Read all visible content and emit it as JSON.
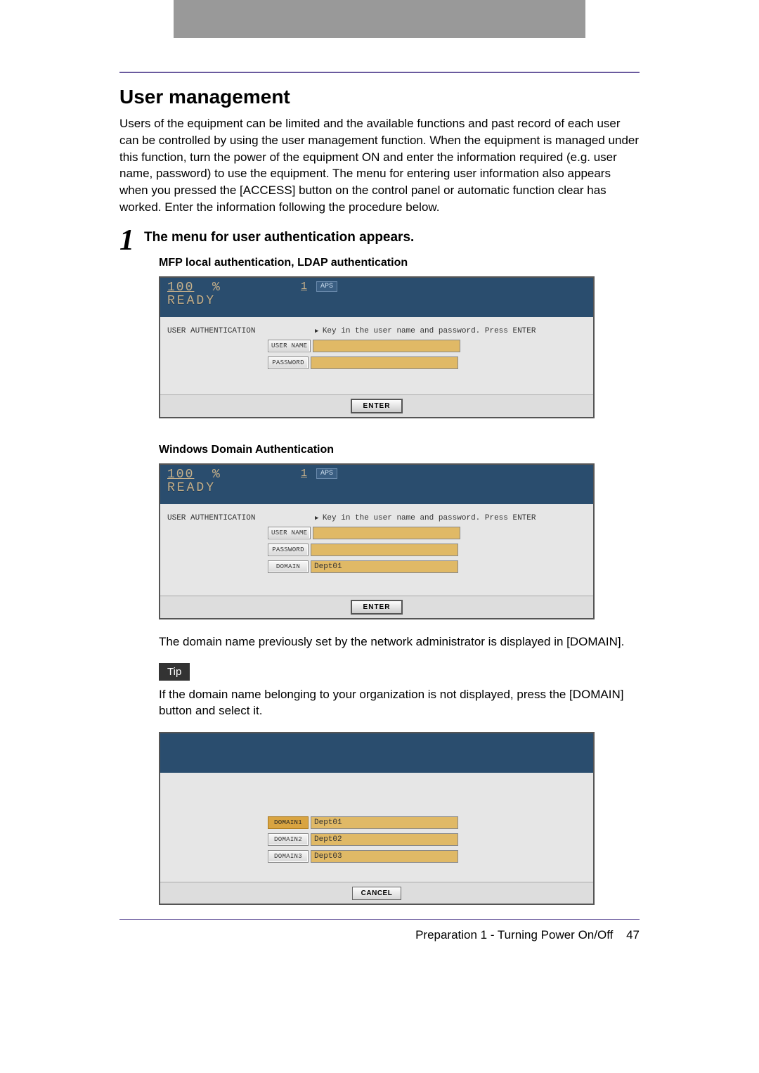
{
  "heading": "User management",
  "intro": "Users of the equipment can be limited and the available functions and past record of each user can be controlled by using the user management function. When the equipment is managed under this function, turn the power of the equipment ON and enter the information required (e.g. user name, password) to use the equipment. The menu for entering user information also appears when you pressed the [ACCESS] button on the control panel or automatic function clear has worked. Enter the information following the procedure below.",
  "step": {
    "num": "1",
    "title": "The menu for user authentication appears.",
    "sub1": "MFP local authentication, LDAP authentication",
    "sub2": "Windows Domain Authentication"
  },
  "panel": {
    "percent": "100",
    "pct_sym": "%",
    "ready": "READY",
    "one": "1",
    "aps": "APS",
    "ua": "USER AUTHENTICATION",
    "instr": "Key in the user name and password. Press ENTER",
    "username_label": "USER NAME",
    "password_label": "PASSWORD",
    "domain_label": "DOMAIN",
    "domain_value": "Dept01",
    "enter": "ENTER",
    "cancel": "CANCEL"
  },
  "after_panel2": "The domain name previously set by the network administrator is displayed in [DOMAIN].",
  "tip_label": "Tip",
  "tip_text": "If the domain name belonging to your organization is not displayed, press the [DOMAIN] button and select it.",
  "domains": {
    "d1_label": "DOMAIN1",
    "d1_val": "Dept01",
    "d2_label": "DOMAIN2",
    "d2_val": "Dept02",
    "d3_label": "DOMAIN3",
    "d3_val": "Dept03"
  },
  "footer": {
    "text": "Preparation 1 - Turning Power On/Off",
    "page": "47"
  }
}
